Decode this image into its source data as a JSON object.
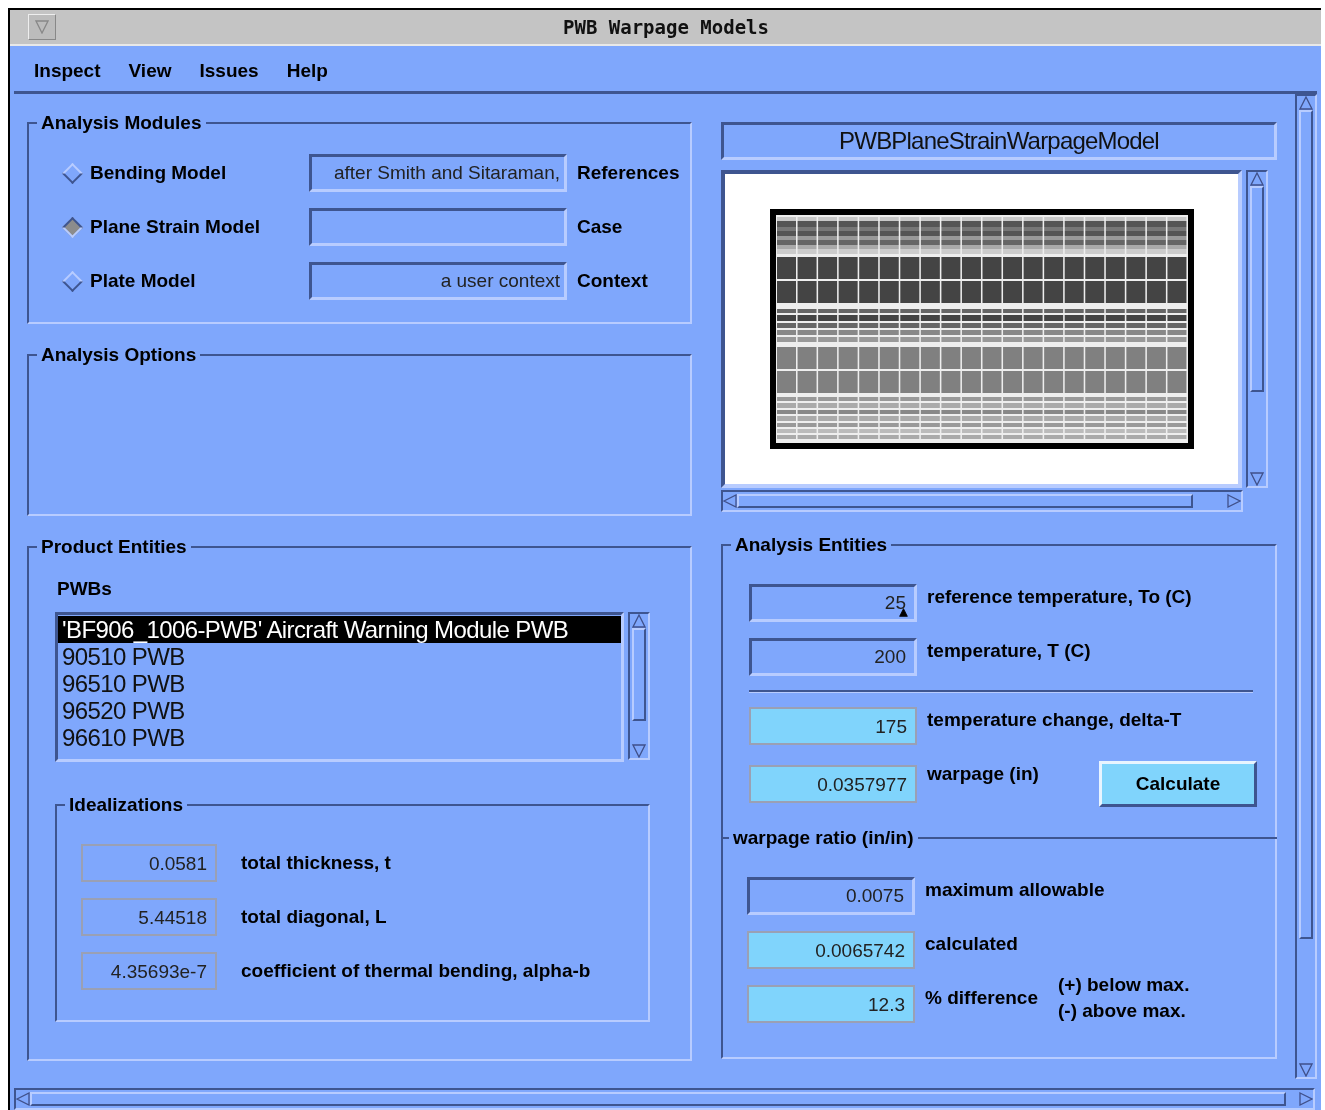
{
  "window": {
    "title": "PWB Warpage Models"
  },
  "menu": [
    {
      "label": "Inspect"
    },
    {
      "label": "View"
    },
    {
      "label": "Issues"
    },
    {
      "label": "Help"
    }
  ],
  "analysis_modules": {
    "title": "Analysis Modules",
    "models": [
      {
        "label": "Bending Model",
        "selected": false
      },
      {
        "label": "Plane Strain Model",
        "selected": true
      },
      {
        "label": "Plate Model",
        "selected": false
      }
    ],
    "fields": [
      {
        "value": "after Smith and Sitaraman,",
        "label": "References"
      },
      {
        "label": "Case"
      },
      {
        "value": "a user context",
        "label": "Context"
      }
    ]
  },
  "analysis_options": {
    "title": "Analysis Options"
  },
  "product_entities": {
    "title": "Product Entities",
    "pwbs": {
      "label": "PWBs",
      "items": [
        {
          "text": "'BF906_1006-PWB' Aircraft Warning Module PWB",
          "selected": true
        },
        {
          "text": "90510 PWB",
          "selected": false
        },
        {
          "text": "96510 PWB",
          "selected": false
        },
        {
          "text": "96520 PWB",
          "selected": false
        },
        {
          "text": "96610 PWB",
          "selected": false
        }
      ]
    },
    "idealizations": {
      "title": "Idealizations",
      "rows": [
        {
          "value": "0.0581",
          "label": "total thickness, t"
        },
        {
          "value": "5.44518",
          "label": "total diagonal, L"
        },
        {
          "value": "4.35693e-7",
          "label": "coefficient of thermal bending, alpha-b"
        }
      ]
    }
  },
  "model_view": {
    "title": "PWBPlaneStrainWarpageModel"
  },
  "analysis_entities": {
    "title": "Analysis Entities",
    "rows": [
      {
        "kind": "input",
        "value": "25",
        "label": "reference temperature, To (C)",
        "cursor": true
      },
      {
        "kind": "input",
        "value": "200",
        "label": "temperature, T (C)"
      },
      {
        "kind": "divider"
      },
      {
        "kind": "output",
        "value": "175",
        "label": "temperature change, delta-T"
      },
      {
        "kind": "output",
        "value": "0.0357977",
        "label": "warpage (in)",
        "button": "Calculate"
      }
    ],
    "ratio": {
      "title": "warpage ratio (in/in)",
      "rows": [
        {
          "kind": "input",
          "value": "0.0075",
          "label": "maximum allowable"
        },
        {
          "kind": "output",
          "value": "0.0065742",
          "label": "calculated"
        },
        {
          "kind": "output",
          "value": "12.3",
          "label": "% difference",
          "notes": [
            "(+) below max.",
            "(-) above max."
          ]
        }
      ]
    }
  }
}
